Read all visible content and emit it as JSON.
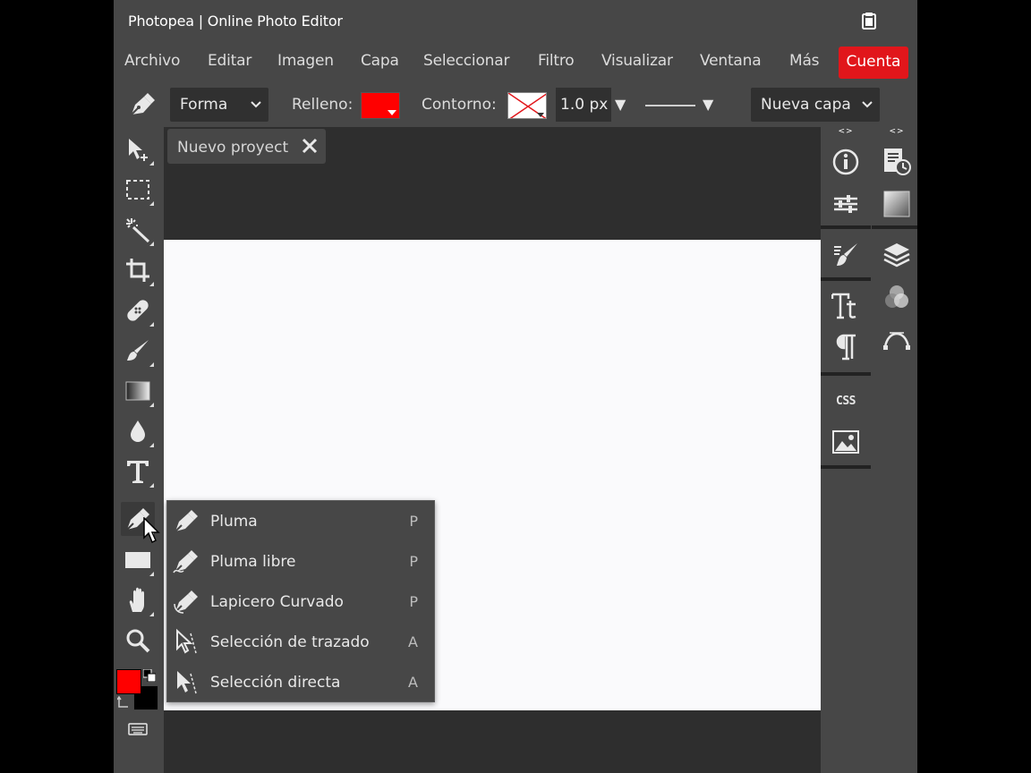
{
  "window": {
    "title": "Photopea | Online Photo Editor"
  },
  "menu": {
    "items": [
      "Archivo",
      "Editar",
      "Imagen",
      "Capa",
      "Seleccionar",
      "Filtro",
      "Visualizar",
      "Ventana",
      "Más"
    ],
    "account": "Cuenta"
  },
  "options": {
    "shape_mode": "Forma",
    "fill_label": "Relleno:",
    "fill_color": "#ff0000",
    "stroke_label": "Contorno:",
    "stroke_width": "1.0 px",
    "layer_mode": "Nueva capa"
  },
  "document": {
    "tab_name": "Nuevo proyecto"
  },
  "tools": [
    {
      "name": "move-icon"
    },
    {
      "name": "marquee-icon"
    },
    {
      "name": "magic-wand-icon"
    },
    {
      "name": "crop-icon"
    },
    {
      "name": "healing-icon"
    },
    {
      "name": "brush-icon"
    },
    {
      "name": "gradient-icon"
    },
    {
      "name": "blur-icon"
    },
    {
      "name": "type-icon"
    },
    {
      "name": "pen-icon"
    },
    {
      "name": "rectangle-icon"
    },
    {
      "name": "hand-icon"
    },
    {
      "name": "zoom-icon"
    }
  ],
  "colors": {
    "foreground": "#ff0000",
    "background": "#000000",
    "accent": "#e1161b"
  },
  "right_panel": {
    "collapse_label": "<>",
    "css_label": "CSS"
  },
  "pen_menu": {
    "items": [
      {
        "label": "Pluma",
        "shortcut": "P",
        "icon": "pen-icon"
      },
      {
        "label": "Pluma libre",
        "shortcut": "P",
        "icon": "freeform-pen-icon"
      },
      {
        "label": "Lapicero Curvado",
        "shortcut": "P",
        "icon": "curvature-pen-icon"
      },
      {
        "label": "Selección de trazado",
        "shortcut": "A",
        "icon": "path-selection-icon"
      },
      {
        "label": "Selección directa",
        "shortcut": "A",
        "icon": "direct-selection-icon"
      }
    ]
  }
}
